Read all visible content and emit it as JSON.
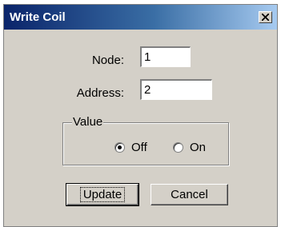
{
  "window": {
    "title": "Write Coil"
  },
  "form": {
    "node_label": "Node:",
    "node_value": "1",
    "address_label": "Address:",
    "address_value": "2",
    "value_group_label": "Value",
    "options": [
      {
        "label": "Off",
        "selected": true
      },
      {
        "label": "On",
        "selected": false
      }
    ]
  },
  "buttons": {
    "update_label": "Update",
    "cancel_label": "Cancel"
  },
  "icons": {
    "close": "close-icon"
  }
}
